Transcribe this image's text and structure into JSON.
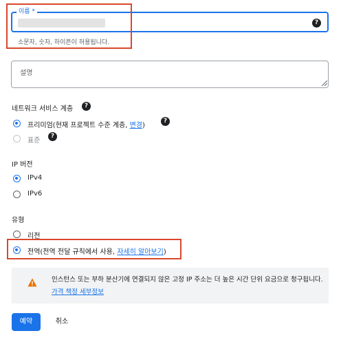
{
  "name_field": {
    "label": "이름 *",
    "hint": "소문자, 숫자, 하이픈이 허용됩니다."
  },
  "description": {
    "placeholder": "설명"
  },
  "network_tier": {
    "title": "네트워크 서비스 계층",
    "premium_label": "프리미엄(현재 프로젝트 수준 계층,",
    "premium_link": "변경",
    "premium_close": ")",
    "standard_label": "표준"
  },
  "ip_version": {
    "title": "IP 버전",
    "options": [
      "IPv4",
      "IPv6"
    ],
    "selected": "IPv4"
  },
  "type": {
    "title": "유형",
    "regional_label": "리전",
    "global_label": "전역(전역 전달 규칙에서 사용,",
    "global_link": "자세히 알아보기",
    "global_close": ")",
    "selected": "전역"
  },
  "notice": {
    "text": "인스턴스 또는 부하 분산기에 연결되지 않은 고정 IP 주소는 더 높은 시간 단위 요금으로 청구됩니다.",
    "link": "가격 책정 세부정보"
  },
  "actions": {
    "reserve": "예약",
    "cancel": "취소"
  },
  "colors": {
    "accent": "#1a73e8",
    "highlight": "#d9472b",
    "warning": "#e37400"
  }
}
